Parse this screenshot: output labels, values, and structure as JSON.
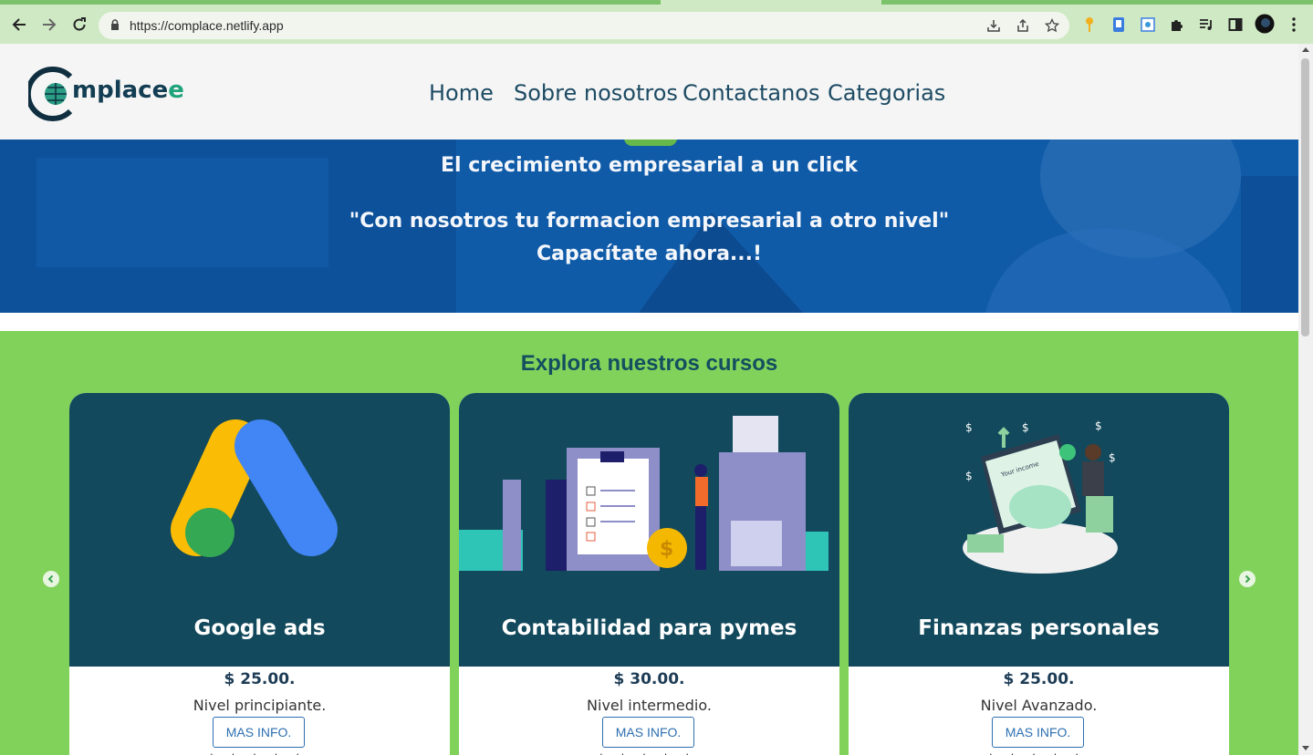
{
  "browser": {
    "url": "https://complace.netlify.app"
  },
  "header": {
    "logo_text": "mplace",
    "logo_last_letter": "e",
    "nav": [
      "Home",
      "Sobre nosotros",
      "Contactanos",
      "Categorias"
    ]
  },
  "hero": {
    "title": "El crecimiento empresarial a un click",
    "quote": "\"Con nosotros tu formacion empresarial a otro nivel\"",
    "cta_text": "Capacítate ahora...!"
  },
  "courses": {
    "title": "Explora nuestros cursos",
    "items": [
      {
        "name": "Google ads",
        "price": "$ 25.00.",
        "level": "Nivel principiante.",
        "button": "MAS INFO.",
        "stars": "★★★★★"
      },
      {
        "name": "Contabilidad para pymes",
        "price": "$ 30.00.",
        "level": "Nivel intermedio.",
        "button": "MAS INFO.",
        "stars": "★★★★★"
      },
      {
        "name": "Finanzas personales",
        "price": "$ 25.00.",
        "level": "Nivel Avanzado.",
        "button": "MAS INFO.",
        "stars": "★★★★★"
      }
    ],
    "illustration_text": "Your income"
  },
  "colors": {
    "header_bg": "#f5f5f5",
    "nav_text": "#1d4b63",
    "courses_bg": "#80d25b",
    "card_top": "#12495c",
    "button_text": "#2d6fb0"
  }
}
